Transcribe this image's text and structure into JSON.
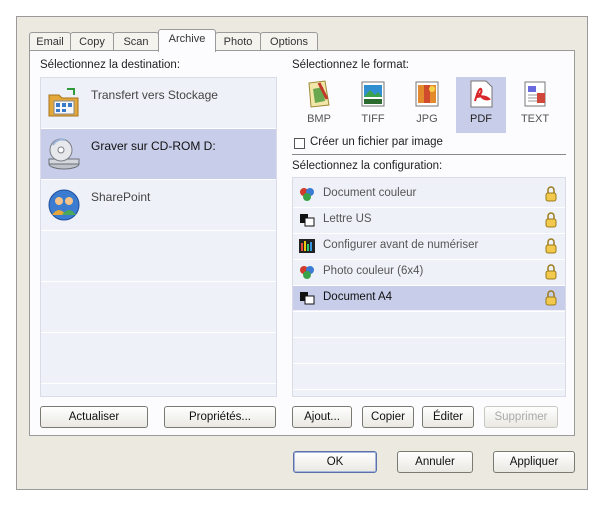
{
  "tabs": [
    {
      "label": "Email",
      "active": false
    },
    {
      "label": "Copy",
      "active": false
    },
    {
      "label": "Scan",
      "active": false
    },
    {
      "label": "Archive",
      "active": true
    },
    {
      "label": "Photo",
      "active": false
    },
    {
      "label": "Options",
      "active": false
    }
  ],
  "destination": {
    "heading": "Sélectionnez la destination:",
    "items": [
      {
        "label": "Transfert vers Stockage",
        "icon": "storage-folder-icon",
        "selected": false
      },
      {
        "label": "Graver sur CD-ROM  D:",
        "icon": "cd-drive-icon",
        "selected": true
      },
      {
        "label": "SharePoint",
        "icon": "sharepoint-icon",
        "selected": false
      }
    ],
    "refresh_button": "Actualiser",
    "properties_button": "Propriétés..."
  },
  "format": {
    "heading": "Sélectionnez le format:",
    "items": [
      {
        "label": "BMP",
        "icon": "bmp-icon",
        "selected": false
      },
      {
        "label": "TIFF",
        "icon": "tiff-icon",
        "selected": false
      },
      {
        "label": "JPG",
        "icon": "jpg-icon",
        "selected": false
      },
      {
        "label": "PDF",
        "icon": "pdf-icon",
        "selected": true
      },
      {
        "label": "TEXT",
        "icon": "text-icon",
        "selected": false
      }
    ],
    "one_file_per_image_label": "Créer un fichier par image",
    "one_file_per_image_checked": false
  },
  "configuration": {
    "heading": "Sélectionnez la configuration:",
    "items": [
      {
        "label": "Document couleur",
        "icon": "color-document-icon",
        "locked": true,
        "selected": false
      },
      {
        "label": "Lettre US",
        "icon": "bw-document-icon",
        "locked": true,
        "selected": false
      },
      {
        "label": "Configurer avant de numériser",
        "icon": "configure-icon",
        "locked": true,
        "selected": false
      },
      {
        "label": "Photo couleur (6x4)",
        "icon": "color-photo-icon",
        "locked": true,
        "selected": false
      },
      {
        "label": "Document A4",
        "icon": "bw-document-icon",
        "locked": true,
        "selected": true
      }
    ],
    "add_button": "Ajout...",
    "copy_button": "Copier",
    "edit_button": "Éditer",
    "delete_button": "Supprimer",
    "delete_enabled": false
  },
  "footer": {
    "ok_button": "OK",
    "cancel_button": "Annuler",
    "apply_button": "Appliquer"
  },
  "colors": {
    "selection": "#c8cde9",
    "list_background": "#eef1f8",
    "dialog_background": "#eceae0"
  }
}
